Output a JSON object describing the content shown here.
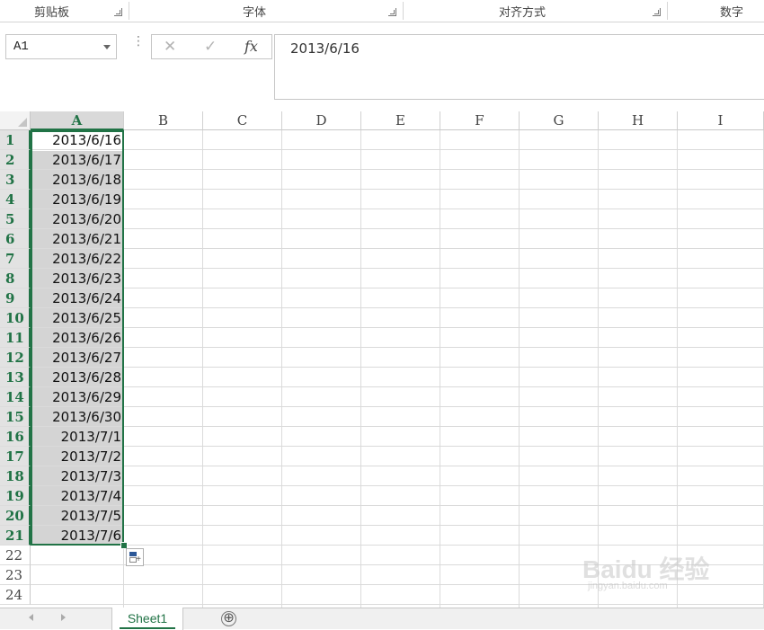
{
  "ribbon": {
    "groups": [
      {
        "label": "剪贴板"
      },
      {
        "label": "字体"
      },
      {
        "label": "对齐方式"
      },
      {
        "label": "数字"
      }
    ]
  },
  "formula_bar": {
    "name_box": "A1",
    "cancel_icon": "✕",
    "enter_icon": "✓",
    "fx_label": "fx",
    "value": "2013/6/16"
  },
  "columns": [
    "A",
    "B",
    "C",
    "D",
    "E",
    "F",
    "G",
    "H",
    "I"
  ],
  "rows": [
    "1",
    "2",
    "3",
    "4",
    "5",
    "6",
    "7",
    "8",
    "9",
    "10",
    "11",
    "12",
    "13",
    "14",
    "15",
    "16",
    "17",
    "18",
    "19",
    "20",
    "21",
    "22",
    "23",
    "24"
  ],
  "cells_A": [
    "2013/6/16",
    "2013/6/17",
    "2013/6/18",
    "2013/6/19",
    "2013/6/20",
    "2013/6/21",
    "2013/6/22",
    "2013/6/23",
    "2013/6/24",
    "2013/6/25",
    "2013/6/26",
    "2013/6/27",
    "2013/6/28",
    "2013/6/29",
    "2013/6/30",
    "2013/7/1",
    "2013/7/2",
    "2013/7/3",
    "2013/7/4",
    "2013/7/5",
    "2013/7/6"
  ],
  "sheets": {
    "active": "Sheet1",
    "add_icon": "⊕"
  },
  "watermark": {
    "line1": "Baidu 经验",
    "line2": "jingyan.baidu.com"
  },
  "colors": {
    "accent": "#217346",
    "selection_fill": "#d4d4d4"
  }
}
